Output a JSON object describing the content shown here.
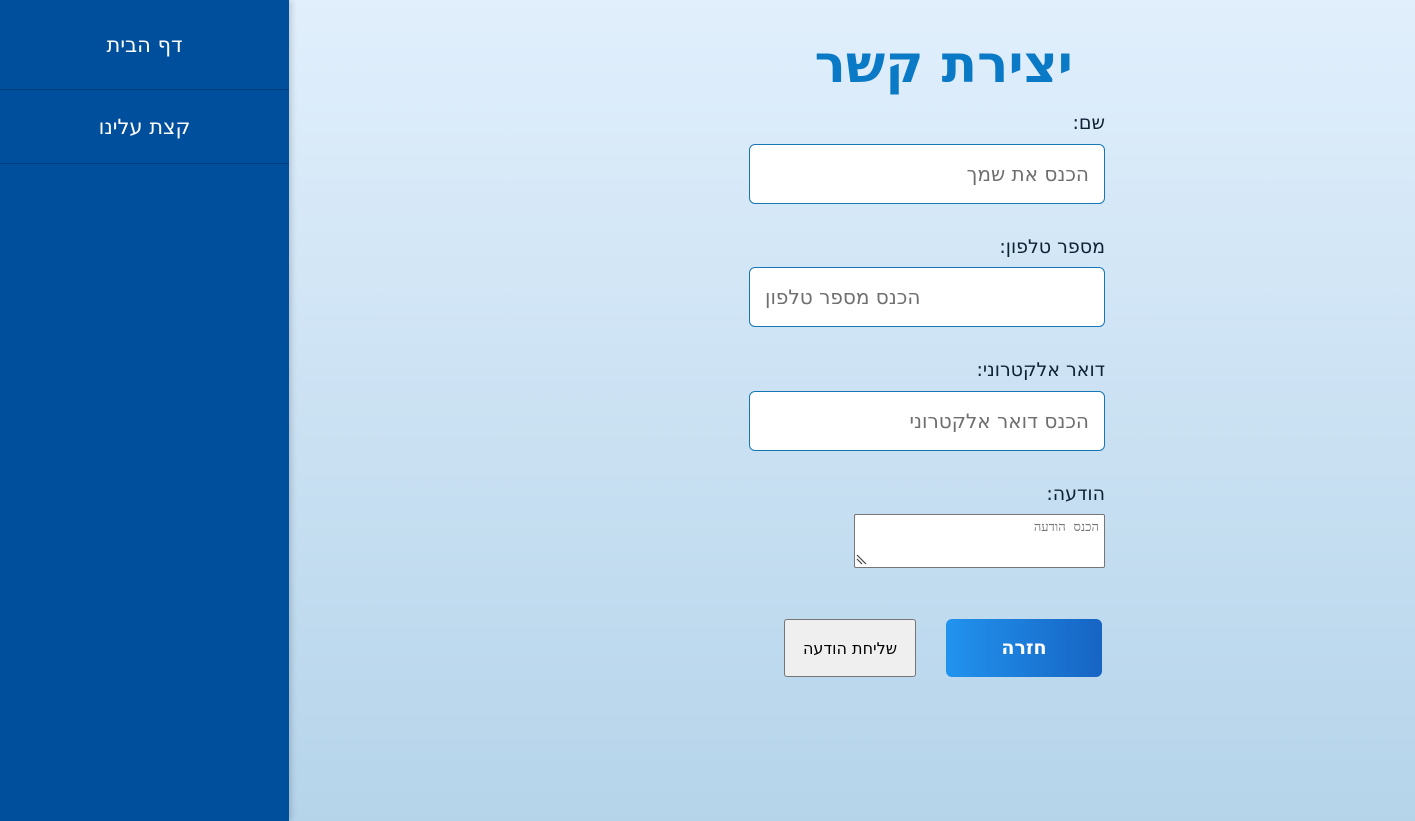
{
  "sidebar": {
    "items": [
      {
        "label": "דף הבית"
      },
      {
        "label": "קצת עלינו"
      }
    ]
  },
  "form": {
    "title": "יצירת קשר",
    "name": {
      "label": "שם:",
      "placeholder": "הכנס את שמך",
      "value": ""
    },
    "phone": {
      "label": "מספר טלפון:",
      "placeholder": "הכנס מספר טלפון",
      "value": ""
    },
    "email": {
      "label": "דואר אלקטרוני:",
      "placeholder": "הכנס דואר אלקטרוני",
      "value": ""
    },
    "message": {
      "label": "הודעה:",
      "placeholder": "הכנס הודעה",
      "value": ""
    }
  },
  "buttons": {
    "send_label": "שליחת הודעה",
    "back_label": "חזרה"
  },
  "colors": {
    "sidebar_bg": "#004f9c",
    "title": "#0a7ac6",
    "input_border": "#1777b5",
    "back_button_start": "#2193ee",
    "back_button_end": "#1764c3"
  }
}
